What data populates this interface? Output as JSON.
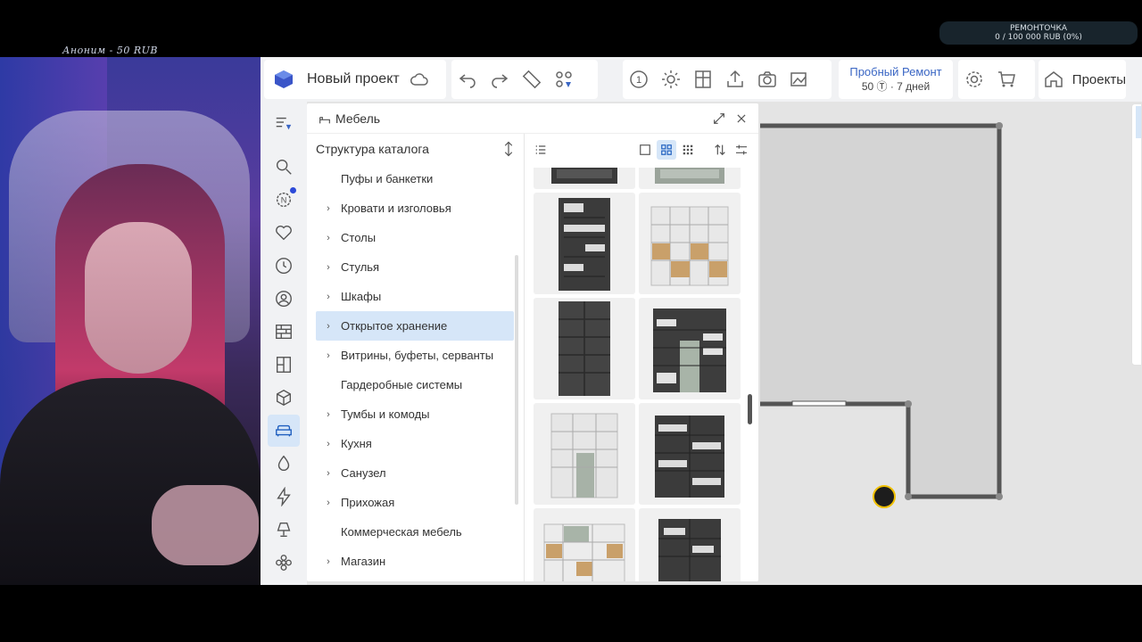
{
  "overlay": {
    "donation_text": "Аноним - 50 RUB",
    "goal_title": "РЕМОНТОЧКА",
    "goal_progress": "0 / 100 000 RUB (0%)"
  },
  "toolbar": {
    "project_name": "Новый проект",
    "trial_label": "Пробный Ремонт",
    "trial_sub": "50 Ⓣ · 7 дней",
    "projects_label": "Проекты",
    "level_number": "1"
  },
  "panel": {
    "title": "Мебель",
    "tree_title": "Структура каталога",
    "items": [
      {
        "label": "Пуфы и банкетки",
        "has_children": false,
        "selected": false
      },
      {
        "label": "Кровати и изголовья",
        "has_children": true,
        "selected": false
      },
      {
        "label": "Столы",
        "has_children": true,
        "selected": false
      },
      {
        "label": "Стулья",
        "has_children": true,
        "selected": false
      },
      {
        "label": "Шкафы",
        "has_children": true,
        "selected": false
      },
      {
        "label": "Открытое хранение",
        "has_children": true,
        "selected": true
      },
      {
        "label": "Витрины, буфеты, серванты",
        "has_children": true,
        "selected": false
      },
      {
        "label": "Гардеробные системы",
        "has_children": false,
        "selected": false
      },
      {
        "label": "Тумбы и комоды",
        "has_children": true,
        "selected": false
      },
      {
        "label": "Кухня",
        "has_children": true,
        "selected": false
      },
      {
        "label": "Санузел",
        "has_children": true,
        "selected": false
      },
      {
        "label": "Прихожая",
        "has_children": true,
        "selected": false
      },
      {
        "label": "Коммерческая мебель",
        "has_children": false,
        "selected": false
      },
      {
        "label": "Магазин",
        "has_children": true,
        "selected": false
      }
    ]
  },
  "colors": {
    "accent": "#1f5fbf",
    "selected_bg": "#d6e6f8",
    "wall": "#555555"
  }
}
